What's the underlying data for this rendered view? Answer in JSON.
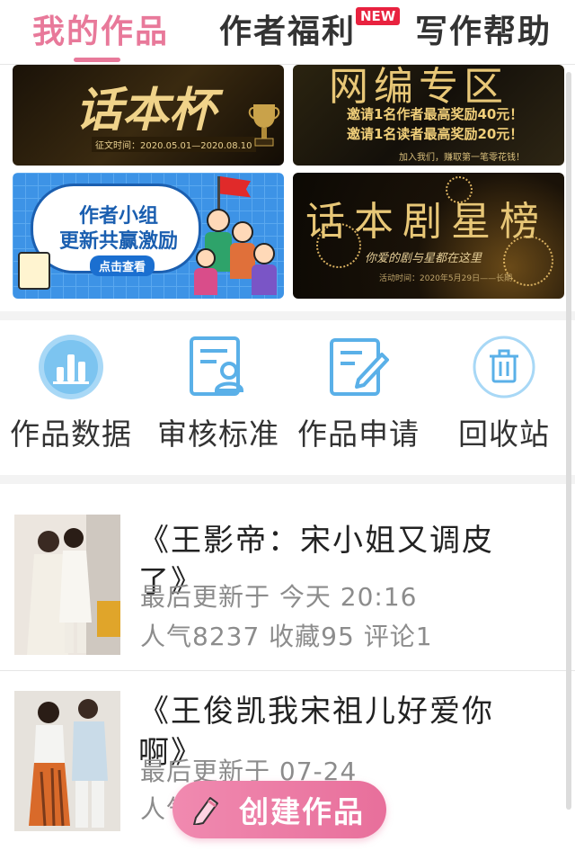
{
  "tabs": [
    {
      "label": "我的作品",
      "active": true
    },
    {
      "label": "作者福利",
      "badge": "NEW",
      "active": false
    },
    {
      "label": "写作帮助",
      "active": false
    }
  ],
  "banners": {
    "b1": {
      "title": "话本杯",
      "date": "征文时间：2020.05.01—2020.08.10"
    },
    "b2": {
      "title": "网编专区",
      "line1": "邀请1名作者最高奖励40元！",
      "line2": "邀请1名读者最高奖励20元！",
      "sub": "加入我们，赚取第一笔零花钱！"
    },
    "b3": {
      "line1": "作者小组",
      "line2": "更新共赢激励",
      "button": "点击查看"
    },
    "b4": {
      "title": "话本剧星榜",
      "sub": "你爱的剧与星都在这里",
      "date": "活动时间：2020年5月29日——长期"
    }
  },
  "tools": [
    {
      "label": "作品数据",
      "icon": "bar-chart-icon"
    },
    {
      "label": "审核标准",
      "icon": "review-standard-icon"
    },
    {
      "label": "作品申请",
      "icon": "edit-document-icon"
    },
    {
      "label": "回收站",
      "icon": "trash-icon"
    }
  ],
  "works": [
    {
      "title": "《王影帝：宋小姐又调皮了》",
      "updated": "最后更新于 今天 20:16",
      "stats": "人气8237 收藏95 评论1"
    },
    {
      "title": "《王俊凯我宋祖儿好爱你啊》",
      "updated": "最后更新于 07-24",
      "stats": "人气 收藏 评论13"
    }
  ],
  "fab": {
    "label": "创建作品"
  },
  "colors": {
    "accent": "#e8799a",
    "tool_icon": "#5ab0e8",
    "badge": "#e8223f"
  }
}
